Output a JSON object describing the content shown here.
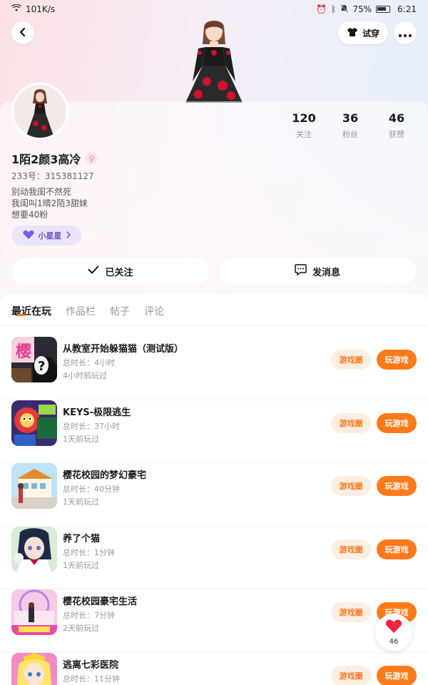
{
  "status_bar": {
    "network_speed": "101K/s",
    "battery": "75%",
    "time": "6:21"
  },
  "header": {
    "try_on_label": "试穿"
  },
  "profile": {
    "nickname": "1陌2颜3高冷",
    "uid": "233号：315381127",
    "bio": [
      "别动我闺不然死",
      "我闺叫1晴2陌3甜妹",
      "想要40粉"
    ],
    "badge_label": "小星星",
    "stats": [
      {
        "value": "120",
        "label": "关注"
      },
      {
        "value": "36",
        "label": "粉丝"
      },
      {
        "value": "46",
        "label": "获赞"
      }
    ]
  },
  "actions": {
    "follow_label": "已关注",
    "message_label": "发消息"
  },
  "tabs": [
    "最近在玩",
    "作品栏",
    "帖子",
    "评论"
  ],
  "games": [
    {
      "name": "从教室开始躲猫猫（测试版）",
      "duration": "总时长：4小时",
      "last_played": "4小时前玩过",
      "circle_label": "游戏圈",
      "play_label": "玩游戏"
    },
    {
      "name": "KEYS-极限逃生",
      "duration": "总时长：37小时",
      "last_played": "1天前玩过",
      "circle_label": "游戏圈",
      "play_label": "玩游戏"
    },
    {
      "name": "樱花校园的梦幻豪宅",
      "duration": "总时长：40分钟",
      "last_played": "1天前玩过",
      "circle_label": "游戏圈",
      "play_label": "玩游戏"
    },
    {
      "name": "养了个猫",
      "duration": "总时长：1分钟",
      "last_played": "1天前玩过",
      "circle_label": "游戏圈",
      "play_label": "玩游戏"
    },
    {
      "name": "樱花校园豪宅生活",
      "duration": "总时长：7分钟",
      "last_played": "2天前玩过",
      "circle_label": "游戏圈",
      "play_label": "玩游戏"
    },
    {
      "name": "逃离七彩医院",
      "duration": "总时长：11分钟",
      "last_played": "",
      "circle_label": "游戏圈",
      "play_label": "玩游戏"
    }
  ],
  "game_icon_text": {
    "icon_0": "樱"
  },
  "like_fab": {
    "count": "46"
  },
  "colors": {
    "accent": "#ff7a1a",
    "accent_light": "#fdeee2",
    "badge_bg": "#ece4fb",
    "badge_text": "#6a4fc8"
  }
}
